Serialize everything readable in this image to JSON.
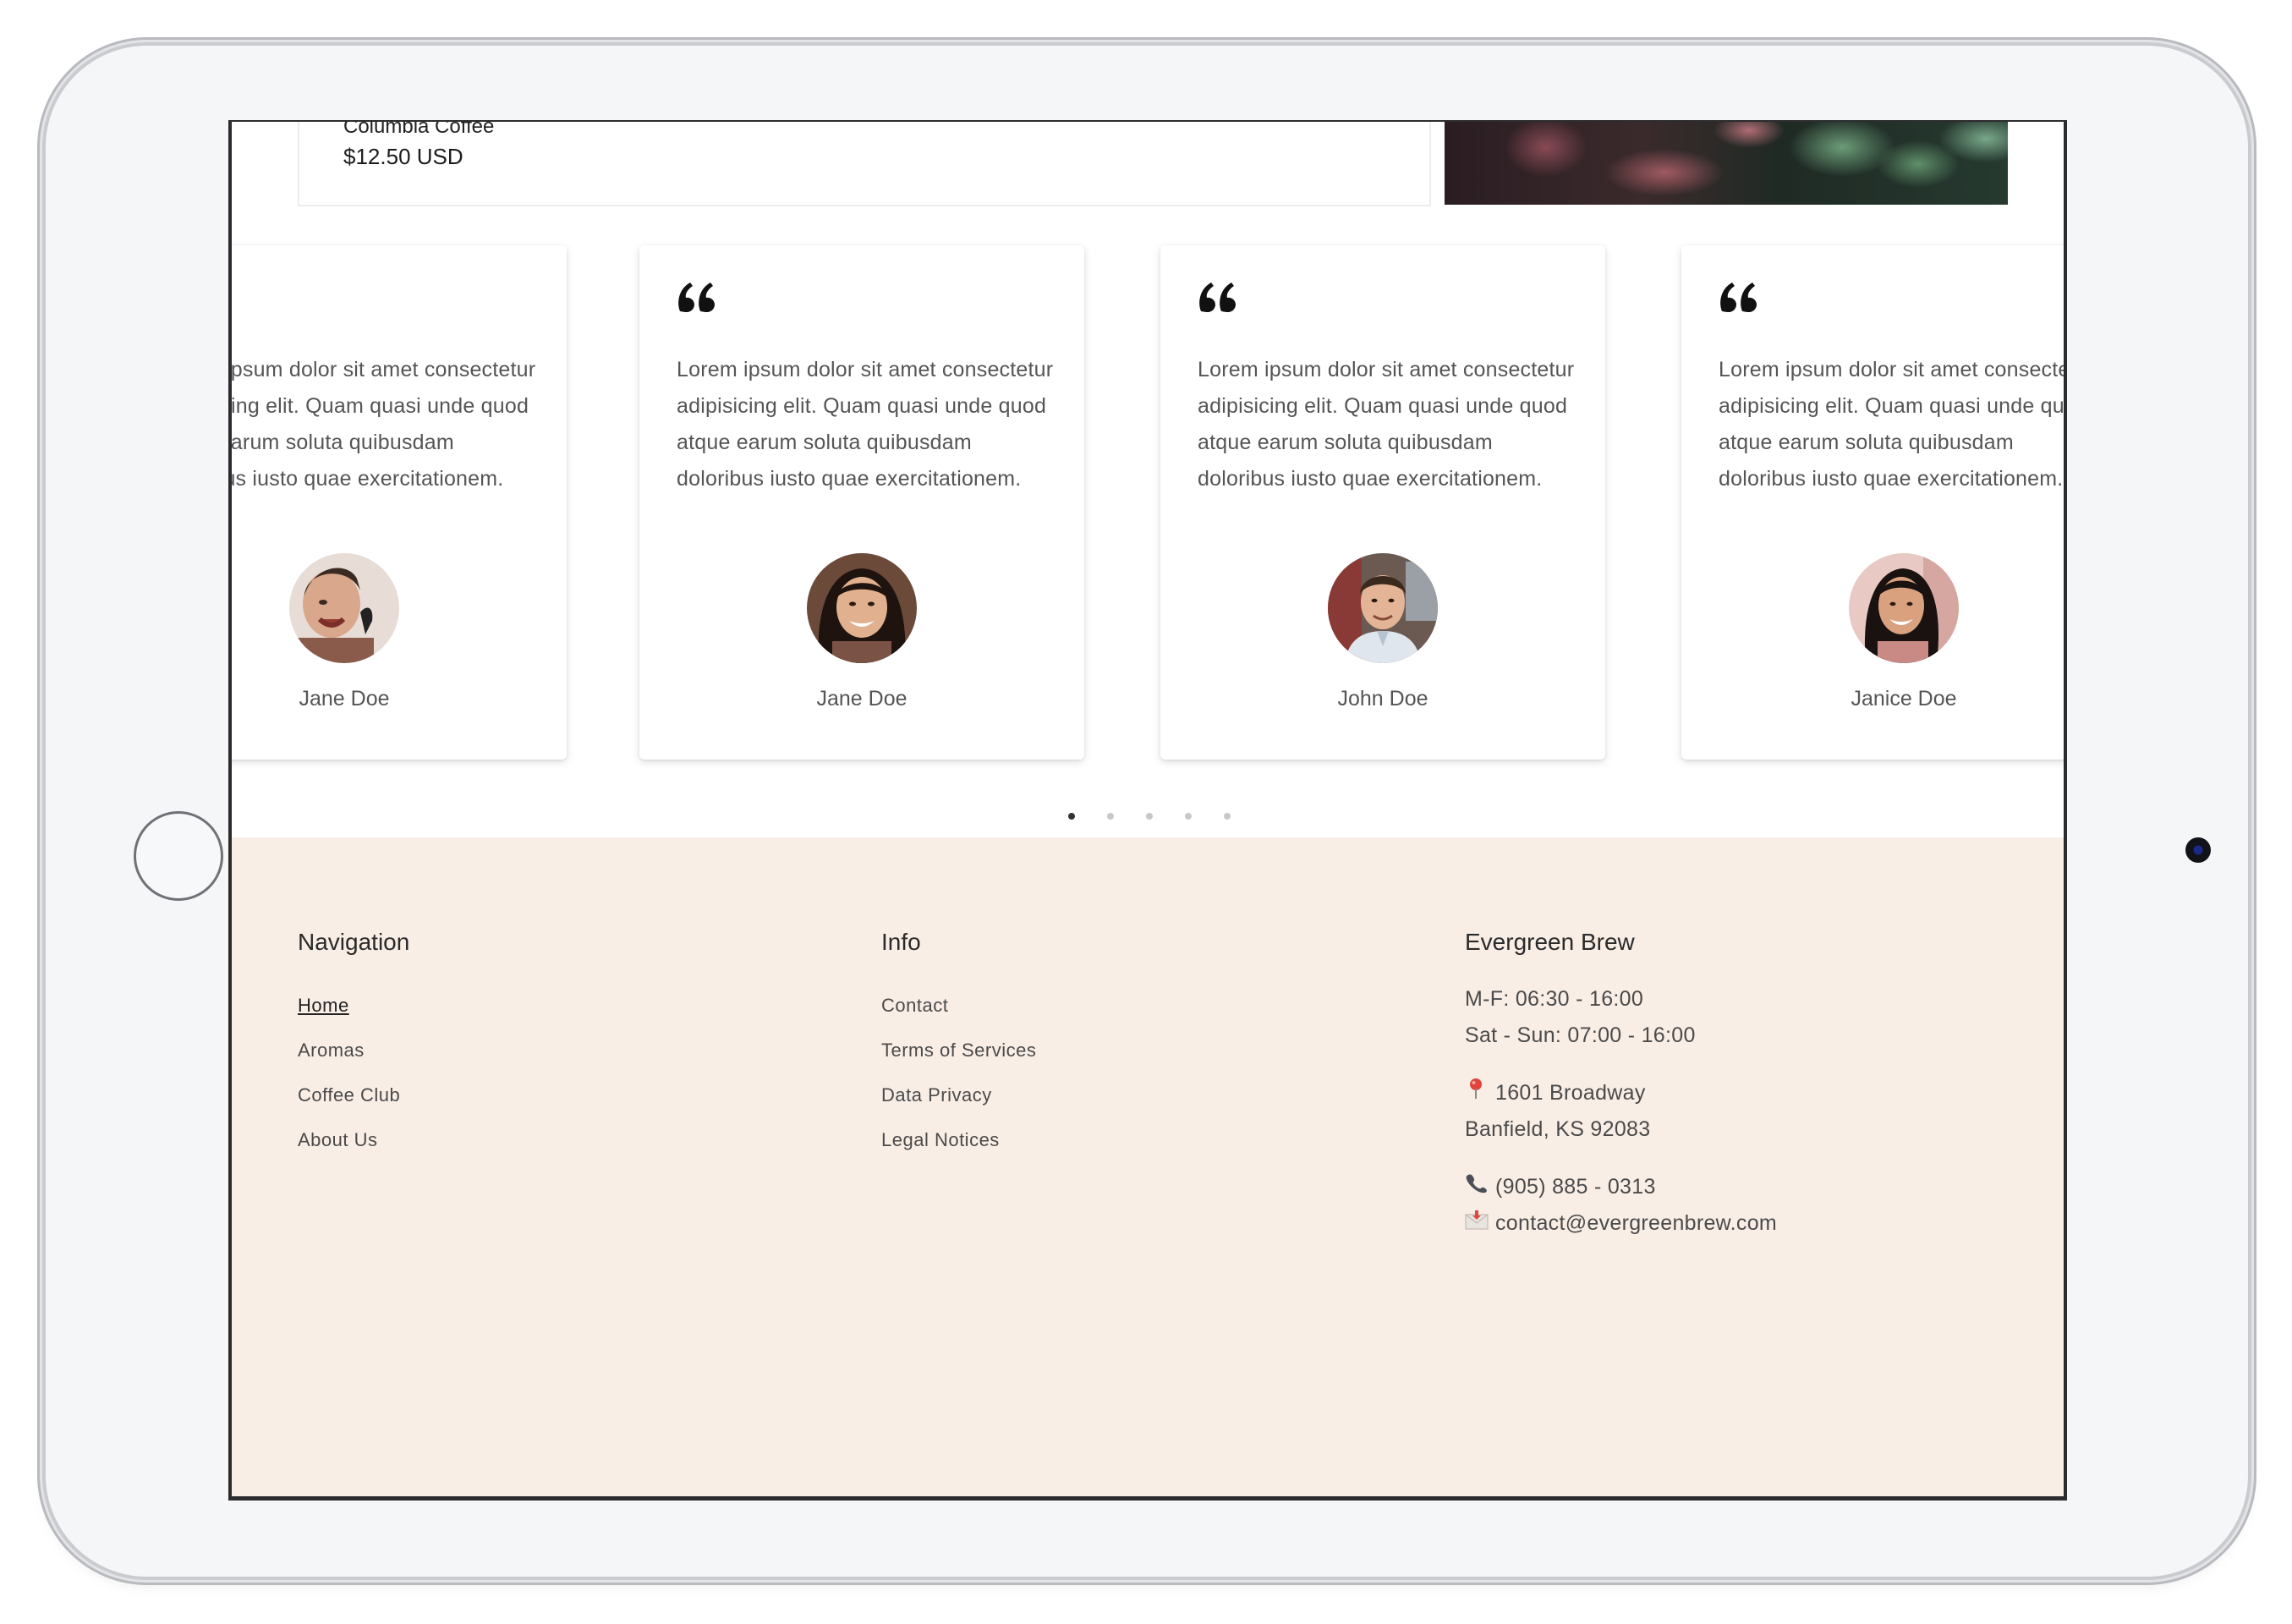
{
  "product": {
    "name": "Columbia Coffee",
    "price": "$12.50 USD"
  },
  "testimonials": [
    {
      "text": "Lorem ipsum dolor sit amet consectetur adipisicing elit. Quam quasi unde quod atque earum soluta quibusdam doloribus iusto quae exercitationem.",
      "name": "Jane Doe"
    },
    {
      "text": "Lorem ipsum dolor sit amet consectetur adipisicing elit. Quam quasi unde quod atque earum soluta quibusdam doloribus iusto quae exercitationem.",
      "name": "Jane Doe"
    },
    {
      "text": "Lorem ipsum dolor sit amet consectetur adipisicing elit. Quam quasi unde quod atque earum soluta quibusdam doloribus iusto quae exercitationem.",
      "name": "John Doe"
    },
    {
      "text": "Lorem ipsum dolor sit amet consectetur adipisicing elit. Quam quasi unde quod atque earum soluta quibusdam doloribus iusto quae exercitationem.",
      "name": "Janice Doe"
    }
  ],
  "carousel": {
    "dot_count": 5,
    "active_index": 0
  },
  "footer": {
    "navigation": {
      "heading": "Navigation",
      "links": [
        "Home",
        "Aromas",
        "Coffee Club",
        "About Us"
      ]
    },
    "info": {
      "heading": "Info",
      "links": [
        "Contact",
        "Terms of Services",
        "Data Privacy",
        "Legal Notices"
      ]
    },
    "business": {
      "heading": "Evergreen Brew",
      "hours_weekday": "M-F: 06:30 - 16:00",
      "hours_weekend": "Sat - Sun: 07:00 - 16:00",
      "address_line1": "1601 Broadway",
      "address_line2": "Banfield, KS 92083",
      "phone": "(905) 885 - 0313",
      "email": "contact@evergreenbrew.com"
    }
  },
  "colors": {
    "footer_bg": "#f9eee6",
    "text": "#4a4a4a",
    "dot_active": "#333333",
    "dot_inactive": "#c8c8c8"
  },
  "icons": {
    "quote": "quote-icon",
    "pin": "map-pin-icon",
    "phone": "phone-icon",
    "email": "envelope-icon"
  }
}
